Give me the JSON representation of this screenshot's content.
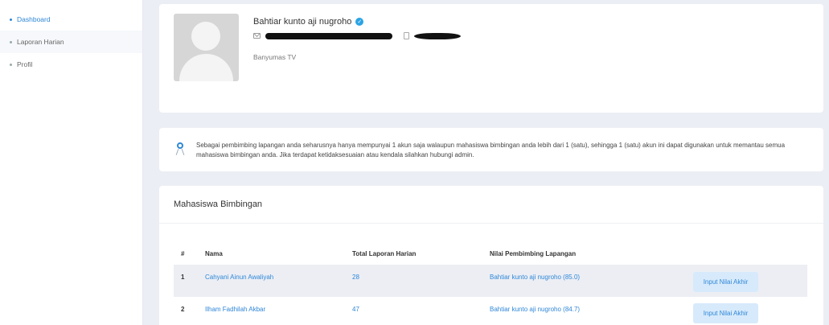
{
  "sidebar": {
    "items": [
      {
        "label": "Dashboard"
      },
      {
        "label": "Laporan Harian"
      },
      {
        "label": "Profil"
      }
    ]
  },
  "profile": {
    "name": "Bahtiar kunto aji nugroho",
    "station": "Banyumas TV",
    "icons": {
      "verified": "check-badge",
      "email": "mail",
      "phone": "phone"
    }
  },
  "notice": {
    "text": "Sebagai pembimbing lapangan anda seharusnya hanya mempunyai 1 akun saja walaupun mahasiswa bimbingan anda lebih dari 1 (satu), sehingga 1 (satu) akun ini dapat digunakan untuk memantau semua mahasiswa bimbingan anda. Jika terdapat ketidaksesuaian atau kendala silahkan hubungi admin."
  },
  "students": {
    "title": "Mahasiswa Bimbingan",
    "columns": [
      "#",
      "Nama",
      "Total Laporan Harian",
      "Nilai Pembimbing Lapangan"
    ],
    "rows": [
      {
        "no": "1",
        "name": "Cahyani Ainun Awaliyah",
        "reports": "28",
        "mentor": "Bahtiar kunto aji nugroho (85.0)",
        "action": "Input Nilai Akhir"
      },
      {
        "no": "2",
        "name": "Ilham Fadhilah Akbar",
        "reports": "47",
        "mentor": "Bahtiar kunto aji nugroho (84.7)",
        "action": "Input Nilai Akhir"
      }
    ]
  },
  "colors": {
    "accent": "#2f87d8",
    "page_bg": "#eceef5",
    "button_bg": "#d7eafb",
    "verified": "#2ba3e4"
  }
}
